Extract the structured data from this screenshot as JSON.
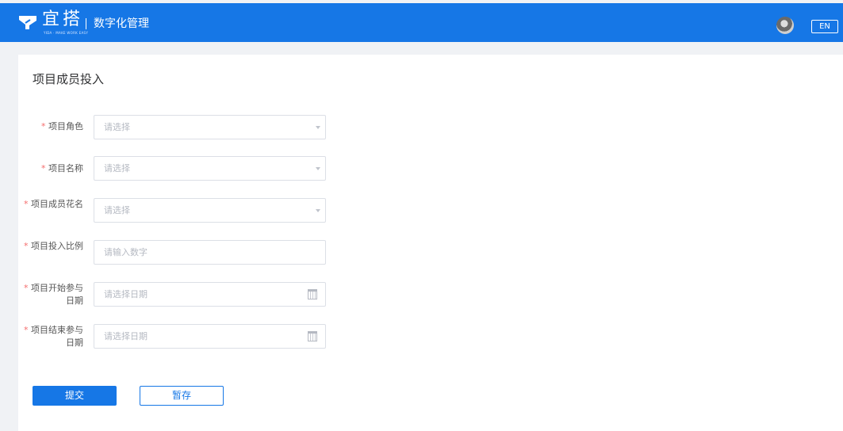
{
  "header": {
    "logo_text": "宜搭",
    "logo_subtext": "YIDA · MAKE WORK EASY",
    "app_title": "数字化管理",
    "lang_button": "EN"
  },
  "form": {
    "title": "项目成员投入",
    "required_mark": "*",
    "fields": [
      {
        "label": "项目角色",
        "placeholder": "请选择",
        "type": "select"
      },
      {
        "label": "项目名称",
        "placeholder": "请选择",
        "type": "select"
      },
      {
        "label": "项目成员花名",
        "placeholder": "请选择",
        "type": "select"
      },
      {
        "label": "项目投入比例",
        "placeholder": "请输入数字",
        "type": "number"
      },
      {
        "label": "项目开始参与日期",
        "placeholder": "请选择日期",
        "type": "date"
      },
      {
        "label": "项目结束参与日期",
        "placeholder": "请选择日期",
        "type": "date"
      }
    ],
    "submit_label": "提交",
    "save_draft_label": "暂存"
  },
  "colors": {
    "brand": "#1677e6",
    "required": "#f56c6c"
  },
  "icons": [
    "logo-icon",
    "avatar",
    "chevron-down-icon",
    "calendar-icon"
  ]
}
